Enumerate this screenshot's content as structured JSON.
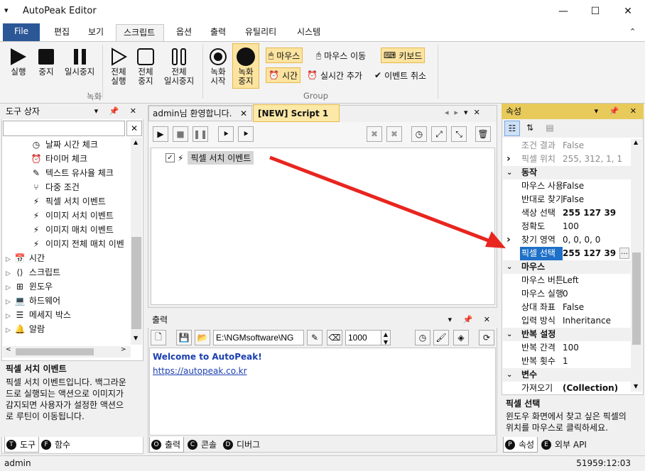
{
  "app": {
    "title": "AutoPeak Editor",
    "sys_icon": "▾",
    "minimize": "—",
    "maximize": "☐",
    "close": "✕"
  },
  "menu": {
    "file": "File",
    "tabs": [
      "편집",
      "보기",
      "스크립트",
      "옵션",
      "출력",
      "유틸리티",
      "시스템"
    ],
    "active": "스크립트",
    "collapse": "⌃"
  },
  "ribbon": {
    "rec_group": "녹화",
    "group2": "Group",
    "btn_run": "실행",
    "btn_stop": "중지",
    "btn_pause": "일시중지",
    "btn_run_all_1": "전체",
    "btn_run_all_2": "실행",
    "btn_stop_all_1": "전체",
    "btn_stop_all_2": "중지",
    "btn_pause_all_1": "전체",
    "btn_pause_all_2": "일시중지",
    "btn_rec_start_1": "녹화",
    "btn_rec_start_2": "시작",
    "btn_rec_stop_1": "녹화",
    "btn_rec_stop_2": "중지",
    "mouse": "마우스",
    "mouse_move": "마우스 이동",
    "keyboard": "키보드",
    "time": "시간",
    "realtime_add": "실시간 추가",
    "event_cancel": "이벤트 취소"
  },
  "toolbox": {
    "title": "도구 상자",
    "search_placeholder": "",
    "items": [
      {
        "icon": "clock",
        "label": "날짜 시간 체크",
        "level": 2
      },
      {
        "icon": "alarm",
        "label": "타이머 체크",
        "level": 2
      },
      {
        "icon": "pen",
        "label": "텍스트 유사율 체크",
        "level": 2
      },
      {
        "icon": "branch",
        "label": "다중 조건",
        "level": 2
      },
      {
        "icon": "bolt",
        "label": "픽셀 서치 이벤트",
        "level": 2
      },
      {
        "icon": "bolt",
        "label": "이미지 서치 이벤트",
        "level": 2
      },
      {
        "icon": "bolt",
        "label": "이미지 매치 이벤트",
        "level": 2
      },
      {
        "icon": "bolt",
        "label": "이미지 전체 매치 이벤",
        "level": 2
      },
      {
        "icon": "calendar",
        "label": "시간",
        "level": 1
      },
      {
        "icon": "code",
        "label": "스크립트",
        "level": 1
      },
      {
        "icon": "windows",
        "label": "윈도우",
        "level": 1
      },
      {
        "icon": "laptop",
        "label": "하드웨어",
        "level": 1
      },
      {
        "icon": "message",
        "label": "메세지 박스",
        "level": 1
      },
      {
        "icon": "bell",
        "label": "알람",
        "level": 1
      }
    ],
    "desc_title": "픽셀 서치 이벤트",
    "desc_lines": [
      "픽셀 서치 이벤트입니다. 백그라운",
      "드로 실행되는 액션으로 이미지가",
      "감지되면 사용자가 설정한 액션으",
      "로 루틴이 이동됩니다."
    ],
    "tab_tool": "도구",
    "tab_func": "함수"
  },
  "editor": {
    "tab1": "admin님 환영합니다.",
    "tab2": "[NEW] Script 1",
    "node_label": "픽셀 서치 이벤트"
  },
  "output": {
    "title": "출력",
    "path": "E:\\NGMsoftware\\NG",
    "count": "1000",
    "welcome": "Welcome to AutoPeak!",
    "link": "https://autopeak.co.kr",
    "tab_output": "출력",
    "tab_console": "콘솔",
    "tab_debug": "디버그"
  },
  "props": {
    "title": "속성",
    "rows": [
      {
        "type": "row",
        "k": "조건 결과",
        "v": "False",
        "dim": true
      },
      {
        "type": "row",
        "k": "픽셀 위치",
        "v": "255, 312, 1, 1",
        "dim": true,
        "exp": true
      },
      {
        "type": "cat",
        "k": "동작"
      },
      {
        "type": "row",
        "k": "마우스 사용",
        "v": "False"
      },
      {
        "type": "row",
        "k": "반대로 찾기",
        "v": "False"
      },
      {
        "type": "row",
        "k": "색상 선택",
        "v": "255 127 39",
        "bold": true
      },
      {
        "type": "row",
        "k": "정확도",
        "v": "100"
      },
      {
        "type": "row",
        "k": "찾기 영역",
        "v": "0, 0, 0, 0",
        "exp": true
      },
      {
        "type": "row",
        "k": "픽셀 선택",
        "v": "255 127 39",
        "bold": true,
        "sel": true
      },
      {
        "type": "cat",
        "k": "마우스"
      },
      {
        "type": "row",
        "k": "마우스 버튼",
        "v": "Left"
      },
      {
        "type": "row",
        "k": "마우스 실행",
        "v": "0"
      },
      {
        "type": "row",
        "k": "상대 좌표",
        "v": "False"
      },
      {
        "type": "row",
        "k": "입력 방식",
        "v": "Inheritance"
      },
      {
        "type": "cat",
        "k": "반복 설정"
      },
      {
        "type": "row",
        "k": "반복 간격",
        "v": "100"
      },
      {
        "type": "row",
        "k": "반복 횟수",
        "v": "1"
      },
      {
        "type": "cat",
        "k": "변수"
      },
      {
        "type": "row",
        "k": "가져오기",
        "v": "(Collection)",
        "bold": true
      }
    ],
    "desc_title": "픽셀 선택",
    "desc_lines": [
      "윈도우 화면에서 찾고 싶은 픽셀의",
      "위치를 마우스로 클릭하세요."
    ],
    "tab_props": "속성",
    "tab_api": "외부 API"
  },
  "status": {
    "user": "admin",
    "time": "51959:12:03"
  },
  "colors": {
    "accent": "#2b5797",
    "panel_active": "#e8ca5b",
    "highlight": "#fce4a0",
    "arrow": "#e8251f",
    "link": "#1a3fb0"
  }
}
